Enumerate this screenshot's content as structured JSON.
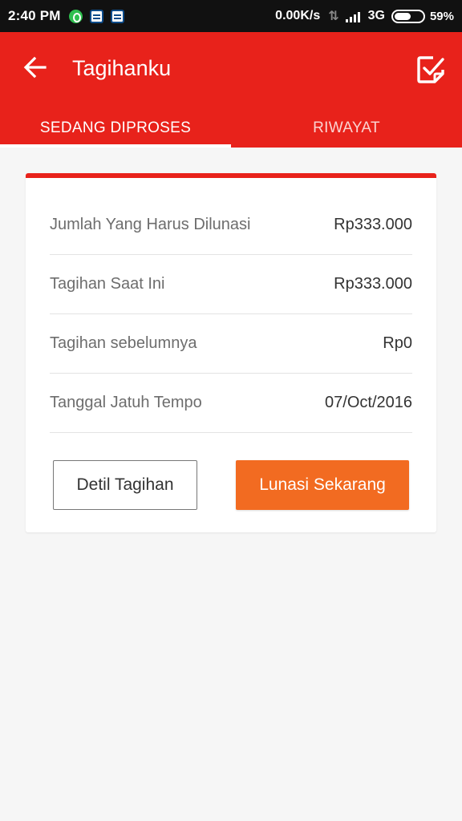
{
  "status_bar": {
    "time": "2:40 PM",
    "speed": "0.00K/s",
    "network": "3G",
    "battery": "59%",
    "battery_level": 0.59,
    "notification_icons": [
      "whatsapp-icon",
      "chat-icon",
      "chat-icon"
    ]
  },
  "app_bar": {
    "title": "Tagihanku",
    "back_icon": "arrow-left-icon",
    "action_icon": "checklist-icon",
    "color": "#e8221b"
  },
  "tabs": [
    {
      "label": "SEDANG DIPROSES",
      "active": true
    },
    {
      "label": "RIWAYAT",
      "active": false
    }
  ],
  "bill": {
    "rows": [
      {
        "label": "Jumlah Yang Harus Dilunasi",
        "value": "Rp333.000"
      },
      {
        "label": "Tagihan Saat Ini",
        "value": "Rp333.000"
      },
      {
        "label": "Tagihan sebelumnya",
        "value": "Rp0"
      },
      {
        "label": "Tanggal Jatuh Tempo",
        "value": "07/Oct/2016"
      }
    ],
    "detail_button": "Detil Tagihan",
    "pay_button": "Lunasi Sekarang",
    "pay_color": "#f26b21"
  }
}
